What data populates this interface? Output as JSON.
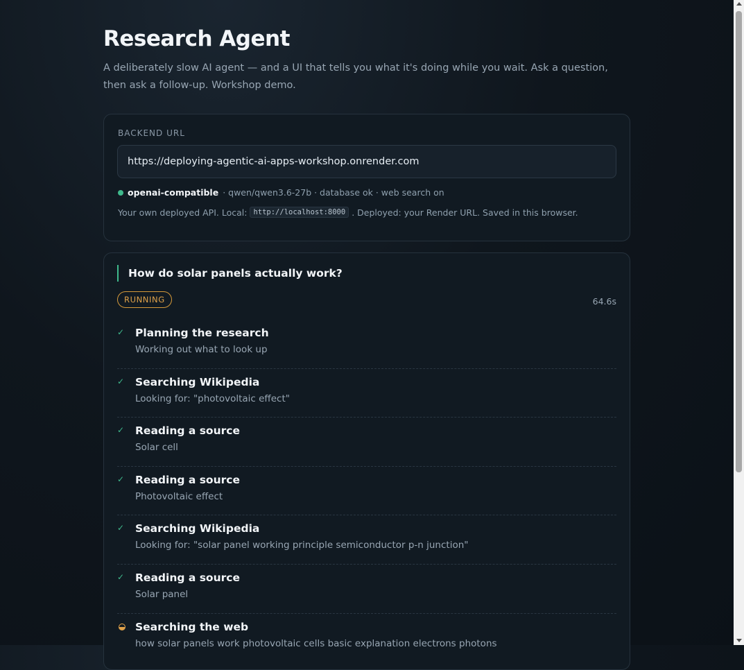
{
  "header": {
    "title": "Research Agent",
    "subtitle": "A deliberately slow AI agent — and a UI that tells you what it's doing while you wait. Ask a question, then ask a follow-up. Workshop demo."
  },
  "backend": {
    "label": "BACKEND URL",
    "url_value": "https://deploying-agentic-ai-apps-workshop.onrender.com",
    "provider": "openai-compatible",
    "status_detail": "· qwen/qwen3.6-27b · database ok · web search on",
    "hint_before": "Your own deployed API. Local:",
    "hint_code": "http://localhost:8000",
    "hint_after": ". Deployed: your Render URL. Saved in this browser."
  },
  "run": {
    "question": "How do solar panels actually work?",
    "status": "RUNNING",
    "elapsed": "64.6s",
    "steps": [
      {
        "title": "Planning the research",
        "detail": "Working out what to look up",
        "state": "done"
      },
      {
        "title": "Searching Wikipedia",
        "detail": "Looking for: \"photovoltaic effect\"",
        "state": "done"
      },
      {
        "title": "Reading a source",
        "detail": "Solar cell",
        "state": "done"
      },
      {
        "title": "Reading a source",
        "detail": "Photovoltaic effect",
        "state": "done"
      },
      {
        "title": "Searching Wikipedia",
        "detail": "Looking for: \"solar panel working principle semiconductor p-n junction\"",
        "state": "done"
      },
      {
        "title": "Reading a source",
        "detail": "Solar panel",
        "state": "done"
      },
      {
        "title": "Searching the web",
        "detail": "how solar panels work photovoltaic cells basic explanation electrons photons",
        "state": "active"
      }
    ]
  },
  "icons": {
    "done": "✓",
    "status_dot_color": "#3fb98c",
    "running_color": "#e0a24a"
  }
}
